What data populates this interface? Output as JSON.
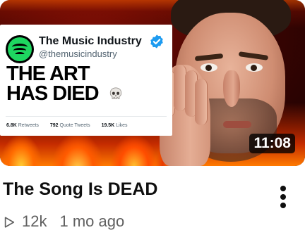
{
  "video": {
    "duration": "11:08",
    "title": "The Song Is DEAD",
    "views": "12k",
    "age": "1 mo ago"
  },
  "thumbnail": {
    "tweet": {
      "account_name": "The Music Industry",
      "handle": "@themusicindustry",
      "headline_line1": "THE ART",
      "headline_line2": "HAS DIED",
      "headline_emoji": "skull-icon",
      "stats": [
        {
          "value": "6.8K",
          "label": "Retweets"
        },
        {
          "value": "792",
          "label": "Quote Tweets"
        },
        {
          "value": "19.5K",
          "label": "Likes"
        }
      ]
    },
    "colors": {
      "spotify_green": "#1ed760",
      "verified_blue": "#1d9bf0",
      "fire_orange": "#ff6a00"
    }
  },
  "icons": {
    "play": "play-outline-icon",
    "more": "three-dot-menu-icon",
    "verified": "verified-badge-icon",
    "avatar": "spotify-logo-icon"
  }
}
